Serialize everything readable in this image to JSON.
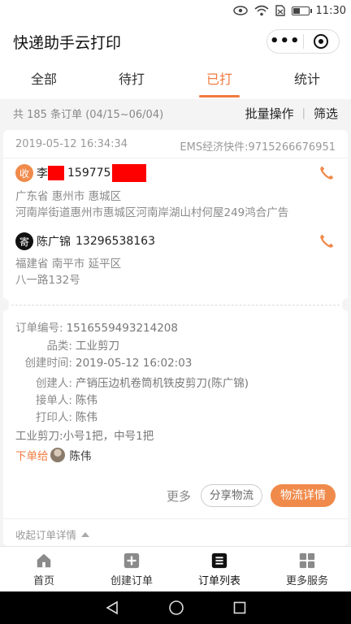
{
  "status_bar": {
    "time": "11:30"
  },
  "app": {
    "title": "快递助手云打印"
  },
  "tabs": [
    {
      "label": "全部"
    },
    {
      "label": "待打"
    },
    {
      "label": "已打",
      "active": true
    },
    {
      "label": "统计"
    }
  ],
  "summary": {
    "count_text": "共 185 条订单 (04/15~06/04)",
    "batch_label": "批量操作",
    "filter_label": "筛选"
  },
  "order": {
    "created_at": "2019-05-12 16:34:34",
    "carrier_waybill": "EMS经济快件:9715266676951",
    "receiver": {
      "badge": "收",
      "name": "李",
      "phone": "159775",
      "province_city": "广东省 惠州市 惠城区",
      "address": "河南岸街道惠州市惠城区河南岸湖山村何屋249鸿合广告"
    },
    "sender": {
      "badge": "寄",
      "name": "陈广锦",
      "phone": "13296538163",
      "province_city": "福建省 南平市 延平区",
      "address": "八一路132号"
    },
    "fields": [
      {
        "k": "订单编号:",
        "v": "1516559493214208"
      },
      {
        "k": "品类:",
        "v": "工业剪刀"
      },
      {
        "k": "创建时间:",
        "v": "2019-05-12 16:02:03"
      },
      {
        "k": "创建人:",
        "v": "产销压边机卷筒机铁皮剪刀(陈广锦)"
      },
      {
        "k": "接单人:",
        "v": "陈伟"
      },
      {
        "k": "打印人:",
        "v": "陈伟"
      }
    ],
    "item_note": "工业剪刀:小号1把，中号1把",
    "assign_label": "下单给",
    "assignee": "陈伟",
    "more_label": "更多",
    "share_label": "分享物流",
    "logistics_label": "物流详情",
    "collapse_label": "收起订单详情"
  },
  "bottom_nav": [
    {
      "label": "首页"
    },
    {
      "label": "创建订单"
    },
    {
      "label": "订单列表",
      "active": true
    },
    {
      "label": "更多服务"
    }
  ],
  "colors": {
    "accent": "#f07b3f",
    "accent_fill": "#f08a4b",
    "redaction": "#ff0000"
  }
}
